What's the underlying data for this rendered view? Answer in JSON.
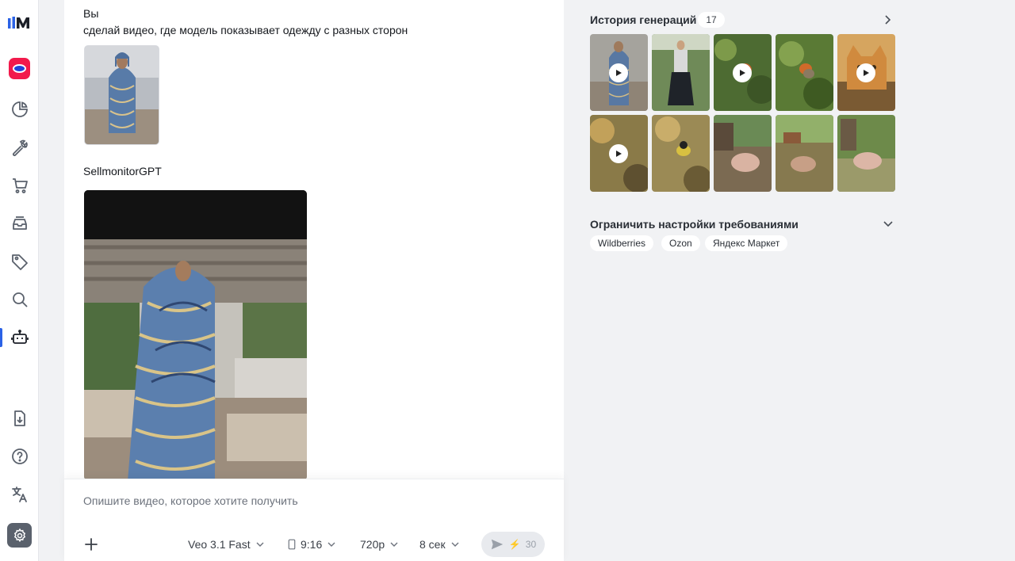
{
  "chat": {
    "user_author": "Вы",
    "user_text": "сделай видео, где модель показывает одежду с разных сторон",
    "bot_author": "SellmonitorGPT"
  },
  "composer": {
    "placeholder": "Опишите видео, которое хотите получить",
    "model": "Veo 3.1 Fast",
    "aspect": "9:16",
    "resolution": "720p",
    "duration": "8 сек",
    "cost": "30"
  },
  "history": {
    "title": "История генераций",
    "count": "17"
  },
  "limits": {
    "title": "Ограничить настройки требованиями",
    "chips": [
      "Wildberries",
      "Ozon",
      "Яндекс Маркет"
    ]
  },
  "sidebar": {
    "items": [
      "analytics-icon",
      "tools-icon",
      "cart-icon",
      "inbox-icon",
      "tag-icon",
      "search-icon",
      "bot-icon",
      "download-icon",
      "help-icon",
      "translate-icon",
      "settings-icon"
    ]
  }
}
